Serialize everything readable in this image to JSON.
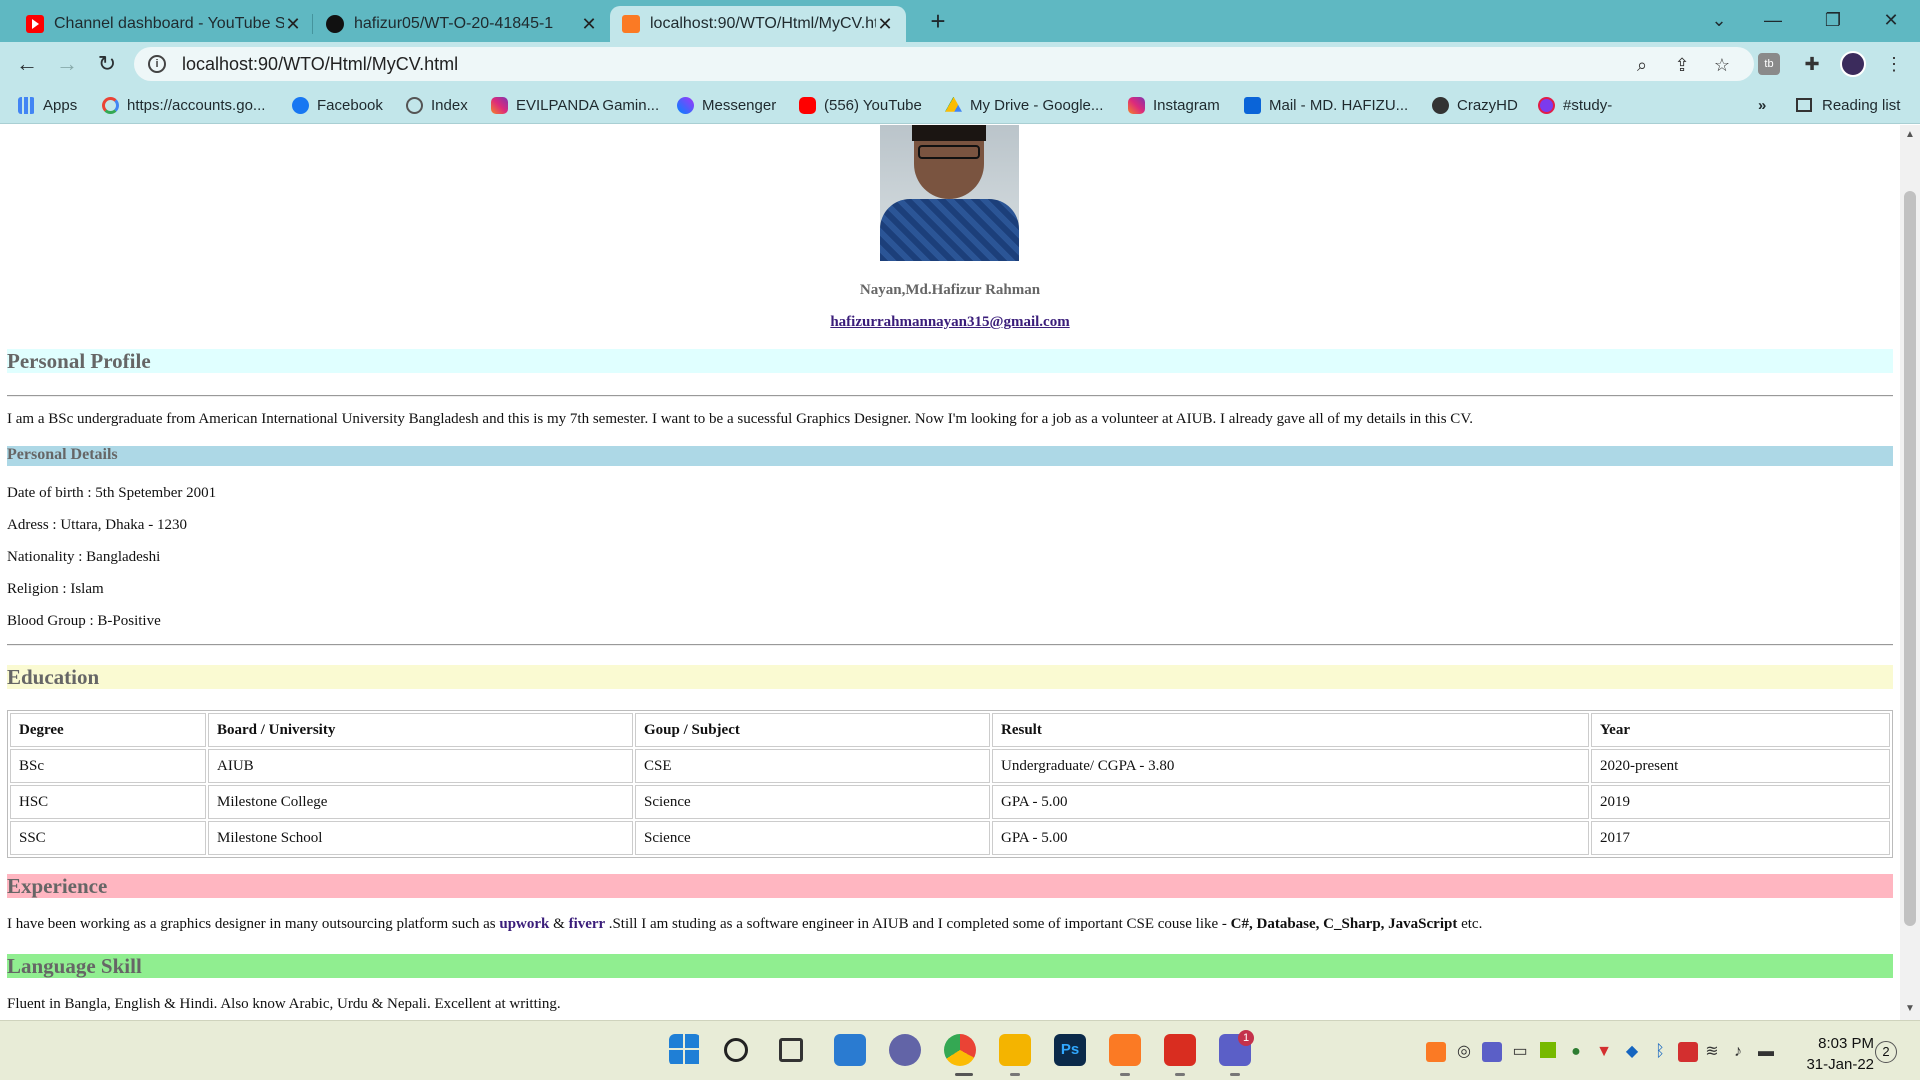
{
  "browser": {
    "tabs": [
      {
        "title": "Channel dashboard - YouTube St",
        "favicon": "youtube-icon",
        "color": "#ff0000"
      },
      {
        "title": "hafizur05/WT-O-20-41845-1",
        "favicon": "github-icon",
        "color": "#111111"
      },
      {
        "title": "localhost:90/WTO/Html/MyCV.ht",
        "favicon": "xampp-icon",
        "color": "#fb7a24"
      }
    ],
    "new_tab_symbol": "+",
    "window_controls": {
      "dropdown": "⌄",
      "minimize": "—",
      "restore": "❐",
      "close": "✕"
    },
    "url": "localhost:90/WTO/Html/MyCV.html",
    "bookmarks": [
      {
        "label": "Apps",
        "icon": "apps-grid-icon",
        "color": "#4285f4"
      },
      {
        "label": "https://accounts.go...",
        "icon": "google-icon",
        "color": "#ea4335"
      },
      {
        "label": "Facebook",
        "icon": "facebook-icon",
        "color": "#1877f2"
      },
      {
        "label": "Index",
        "icon": "index-icon",
        "color": "#555555"
      },
      {
        "label": "EVILPANDA Gamin...",
        "icon": "instagram-icon",
        "color": "#d6249f"
      },
      {
        "label": "Messenger",
        "icon": "messenger-icon",
        "color": "#0084ff"
      },
      {
        "label": "(556) YouTube",
        "icon": "youtube-icon",
        "color": "#ff0000"
      },
      {
        "label": "My Drive - Google...",
        "icon": "google-drive-icon",
        "color": "#fbbc04"
      },
      {
        "label": "Instagram",
        "icon": "instagram-icon",
        "color": "#d6249f"
      },
      {
        "label": "Mail - MD. HAFIZU...",
        "icon": "outlook-icon",
        "color": "#0a64d8"
      },
      {
        "label": "CrazyHD",
        "icon": "crazyhd-icon",
        "color": "#333333"
      },
      {
        "label": "#study-",
        "icon": "study-icon",
        "color": "#7c3aed"
      }
    ],
    "bookmarks_overflow": "»",
    "reading_list": "Reading list"
  },
  "cv": {
    "name": "Nayan,Md.Hafizur Rahman",
    "email": "hafizurrahmannayan315@gmail.com",
    "profile": {
      "heading": "Personal Profile",
      "heading_bg": "#e0ffff",
      "text": "I am a BSc undergraduate from American International University Bangladesh and this is my 7th semester. I want to be a sucessful Graphics Designer. Now I'm looking for a job as a volunteer at AIUB. I already gave all of my details in this CV."
    },
    "details": {
      "heading": "Personal Details",
      "heading_bg": "#add8e6",
      "dob": "Date of birth : 5th Spetember 2001",
      "address": "Adress : Uttara, Dhaka - 1230",
      "nationality": "Nationality : Bangladeshi",
      "religion": "Religion : Islam",
      "blood": "Blood Group : B-Positive"
    },
    "education": {
      "heading": "Education",
      "heading_bg": "#fafad2",
      "columns": [
        "Degree",
        "Board / University",
        "Goup / Subject",
        "Result",
        "Year"
      ],
      "rows": [
        [
          "BSc",
          "AIUB",
          "CSE",
          "Undergraduate/ CGPA - 3.80",
          "2020-present"
        ],
        [
          "HSC",
          "Milestone College",
          "Science",
          "GPA - 5.00",
          "2019"
        ],
        [
          "SSC",
          "Milestone School",
          "Science",
          "GPA - 5.00",
          "2017"
        ]
      ]
    },
    "experience": {
      "heading": "Experience",
      "heading_bg": "#ffb6c1",
      "text_1": "I have been working as a graphics designer in many outsourcing platform such as ",
      "link_1": "upwork ",
      "text_2": "& ",
      "link_2": "fiverr ",
      "text_3": ".Still I am studing as a software engineer in AIUB and I completed some of important CSE couse like - ",
      "skills": "C#, Database, C_Sharp, JavaScript",
      "text_4": " etc."
    },
    "language": {
      "heading": "Language Skill",
      "heading_bg": "#90ee90",
      "text": "Fluent in Bangla, English & Hindi. Also know Arabic, Urdu & Nepali. Excellent at writting."
    }
  },
  "taskbar": {
    "apps": [
      {
        "name": "windows-start-icon",
        "color": "#1f7fd6"
      },
      {
        "name": "search-icon",
        "color": "#222222"
      },
      {
        "name": "task-view-icon",
        "color": "#333333"
      },
      {
        "name": "widgets-icon",
        "color": "#2a7bd1"
      },
      {
        "name": "teams-chat-icon",
        "color": "#6264a7"
      },
      {
        "name": "chrome-icon",
        "color": "#34a853"
      },
      {
        "name": "file-explorer-icon",
        "color": "#f4b400"
      },
      {
        "name": "photoshop-icon",
        "color": "#0b2a4a"
      },
      {
        "name": "xampp-icon",
        "color": "#fb7a24"
      },
      {
        "name": "acrobat-icon",
        "color": "#d92d20"
      },
      {
        "name": "teams-icon",
        "color": "#5b5fc7"
      }
    ],
    "teams_badge": "1",
    "time": "8:03 PM",
    "date": "31-Jan-22",
    "notifications": "2"
  }
}
